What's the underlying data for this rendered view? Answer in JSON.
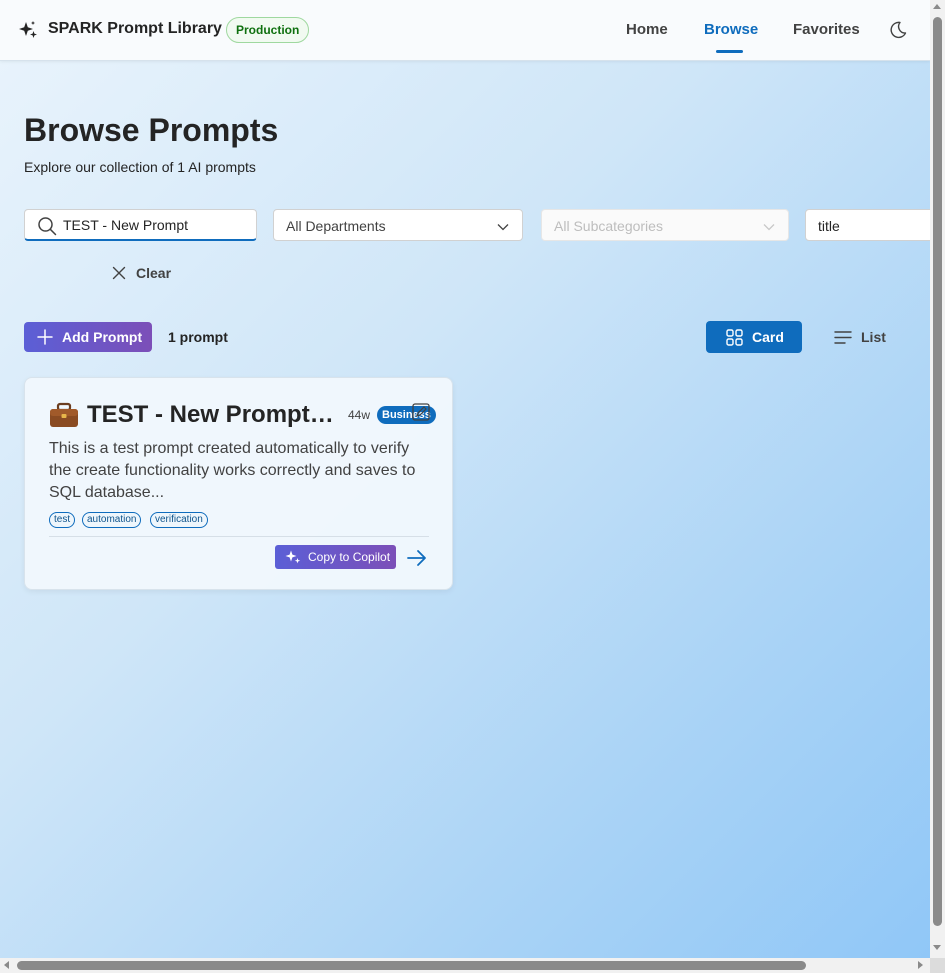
{
  "header": {
    "logo_icon": "sparkle-icon",
    "title": "SPARK Prompt Library",
    "env_badge": "Production",
    "nav": [
      {
        "label": "Home",
        "active": false
      },
      {
        "label": "Browse",
        "active": true
      },
      {
        "label": "Favorites",
        "active": false
      }
    ],
    "theme_icon": "moon-icon"
  },
  "page": {
    "title": "Browse Prompts",
    "subtitle": "Explore our collection of 1 AI prompts"
  },
  "filters": {
    "search_value": "TEST - New Prompt",
    "department": "All Departments",
    "subcategory": "All Subcategories",
    "sort": "title",
    "clear_label": "Clear"
  },
  "actions": {
    "add_label": "Add Prompt",
    "count": "1 prompt",
    "view_card": "Card",
    "view_list": "List",
    "active_view": "Card"
  },
  "cards": [
    {
      "emoji": "briefcase-icon",
      "title": "TEST - New Prompt (Automated Test)",
      "age": "44w",
      "department": "Business",
      "description": "This is a test prompt created automatically to verify the create functionality works correctly and saves to SQL database...",
      "tags": [
        "test",
        "automation",
        "verification"
      ],
      "copilot_label": "Copy to Copilot"
    }
  ],
  "colors": {
    "brand": "#0f6cbd",
    "accent_gradient_start": "#5b5fd6",
    "accent_gradient_end": "#7c4fb8",
    "badge_green": "#0e700e"
  }
}
